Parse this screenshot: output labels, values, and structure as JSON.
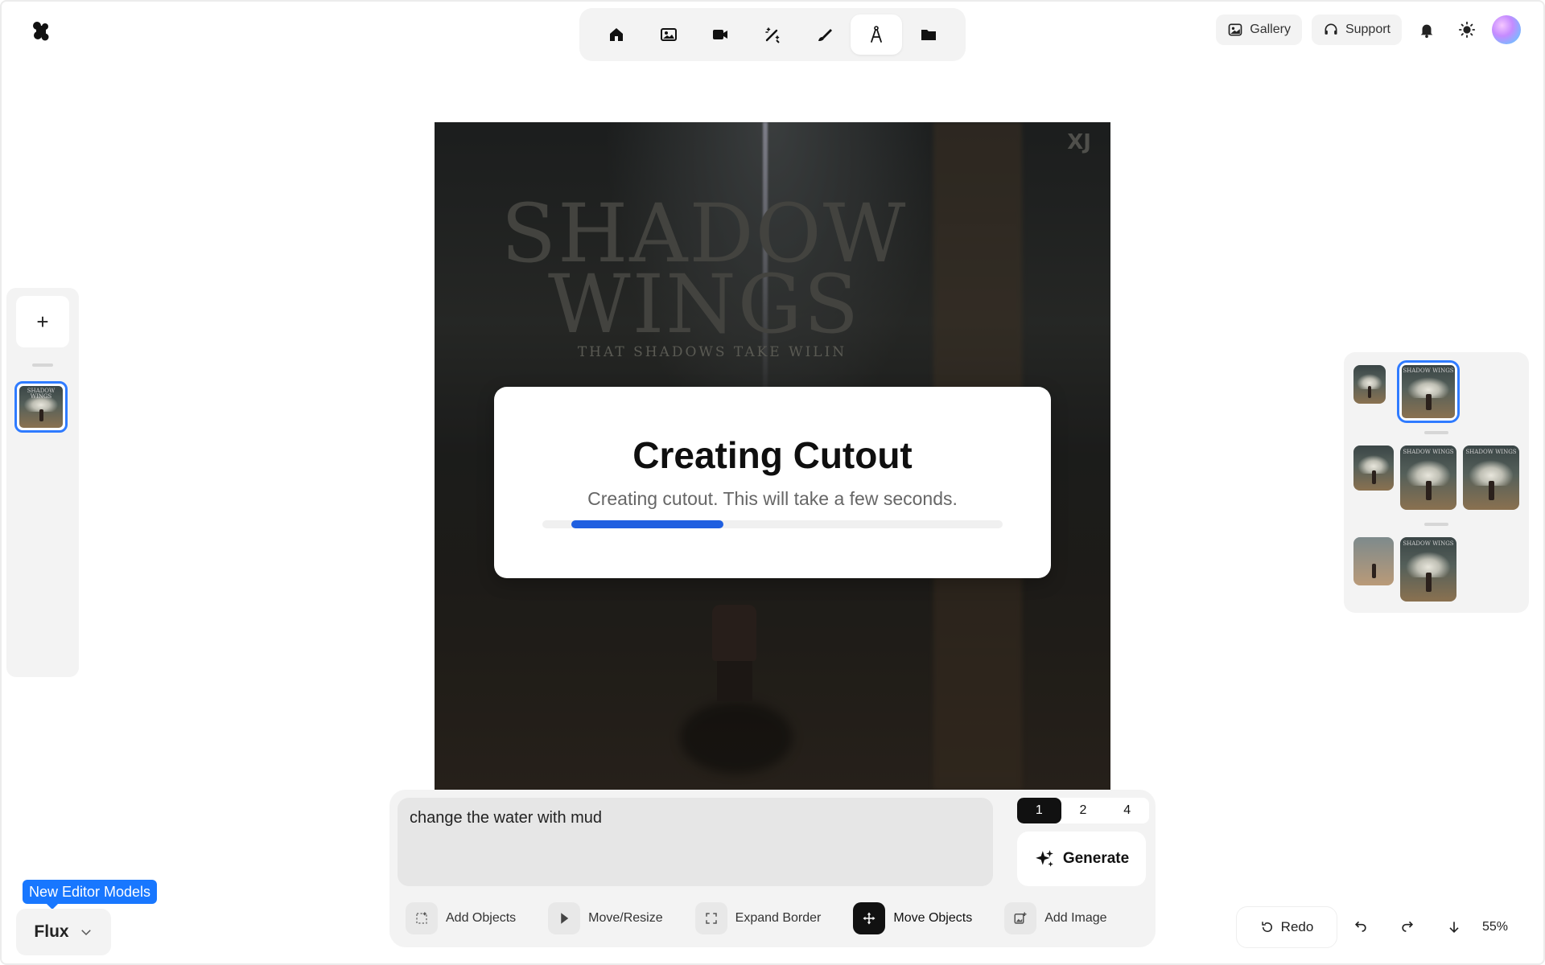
{
  "nav": {
    "items": [
      {
        "name": "home",
        "icon": "home-icon"
      },
      {
        "name": "image",
        "icon": "image-icon"
      },
      {
        "name": "video",
        "icon": "video-icon"
      },
      {
        "name": "magic",
        "icon": "magic-wand-icon"
      },
      {
        "name": "draw",
        "icon": "brush-icon"
      },
      {
        "name": "edit",
        "icon": "compass-icon",
        "active": true
      },
      {
        "name": "folder",
        "icon": "folder-icon"
      }
    ]
  },
  "header": {
    "gallery_label": "Gallery",
    "support_label": "Support"
  },
  "canvas": {
    "poster_title_line1": "SHADOW",
    "poster_title_line2": "WINGS",
    "poster_subtitle": "THAT SHADOWS TAKE WILIN",
    "watermark": "XJ"
  },
  "modal": {
    "title": "Creating Cutout",
    "message": "Creating cutout. This will take a few seconds.",
    "progress": 0.33
  },
  "thumb_text": "SHADOW WINGS",
  "prompt": {
    "value": "change the water with mud",
    "counts": [
      "1",
      "2",
      "4"
    ],
    "active_count": "1",
    "generate_label": "Generate"
  },
  "tools": [
    {
      "label": "Add Objects",
      "icon": "add-objects-icon"
    },
    {
      "label": "Move/Resize",
      "icon": "cursor-icon"
    },
    {
      "label": "Expand Border",
      "icon": "expand-icon"
    },
    {
      "label": "Move Objects",
      "icon": "move-icon",
      "active": true
    },
    {
      "label": "Add Image",
      "icon": "add-image-icon"
    }
  ],
  "model": {
    "badge": "New Editor Models",
    "selected": "Flux"
  },
  "footer": {
    "redo_label": "Redo",
    "zoom": "55%"
  },
  "colors": {
    "accent": "#1f5fe0",
    "badge": "#1877ff",
    "selection": "#2f7bff"
  }
}
